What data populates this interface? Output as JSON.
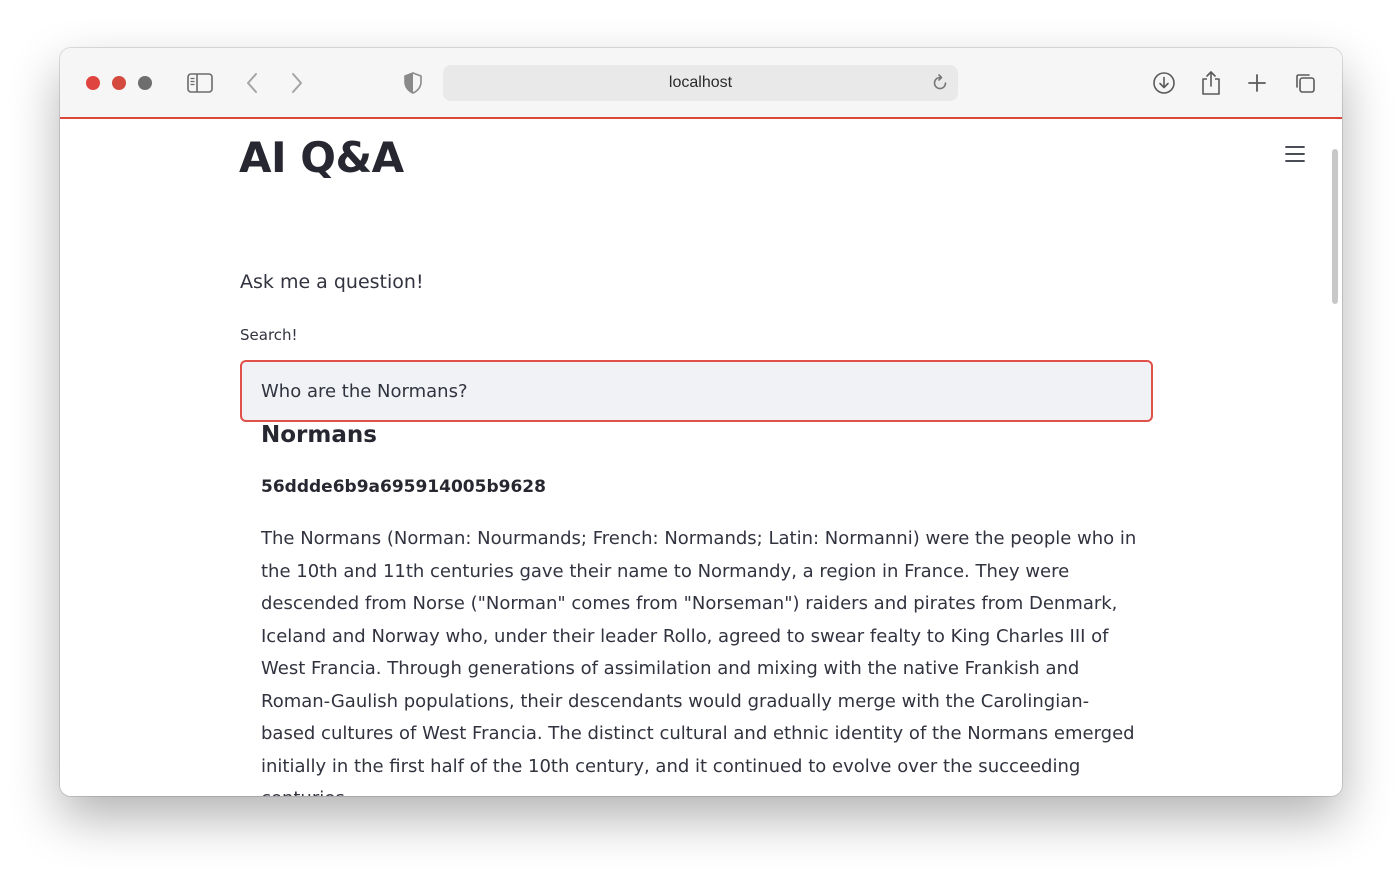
{
  "browser": {
    "url": "localhost",
    "icons": {
      "close": "close-dot-icon",
      "minimize": "minimize-dot-icon",
      "zoom": "zoom-dot-icon",
      "sidebar": "sidebar-toggle-icon",
      "back": "chevron-left-icon",
      "forward": "chevron-right-icon",
      "privacy": "shield-icon",
      "reload": "reload-icon",
      "download": "download-icon",
      "share": "share-icon",
      "new_tab": "plus-icon",
      "tab_overview": "tabs-overview-icon"
    },
    "colors": {
      "close": "#e0443e",
      "minimize": "#d44a3f",
      "zoom": "#6e6e6e",
      "accent": "#d9483b"
    }
  },
  "app": {
    "title": "AI Q&A",
    "intro": "Ask me a question!",
    "menu_icon": "hamburger-menu-icon",
    "search": {
      "label": "Search!",
      "value": "Who are the Normans?"
    },
    "result": {
      "title": "Normans",
      "id": "56ddde6b9a695914005b9628",
      "body": "The Normans (Norman: Nourmands; French: Normands; Latin: Normanni) were the people who in the 10th and 11th centuries gave their name to Normandy, a region in France. They were descended from Norse (\"Norman\" comes from \"Norseman\") raiders and pirates from Denmark, Iceland and Norway who, under their leader Rollo, agreed to swear fealty to King Charles III of West Francia. Through generations of assimilation and mixing with the native Frankish and Roman-Gaulish populations, their descendants would gradually merge with the Carolingian-based cultures of West Francia. The distinct cultural and ethnic identity of the Normans emerged initially in the first half of the 10th century, and it continued to evolve over the succeeding centuries."
    },
    "colors": {
      "input_border": "#e0514a",
      "input_bg": "#f0f2f6",
      "text": "#31333f"
    }
  }
}
